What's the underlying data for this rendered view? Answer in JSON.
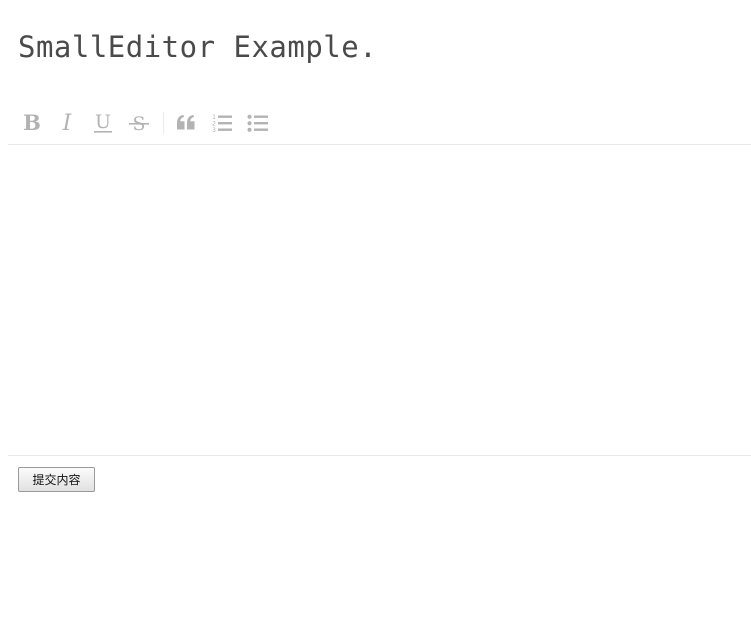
{
  "header": {
    "title": "SmallEditor Example."
  },
  "toolbar": {
    "buttons": [
      {
        "name": "bold",
        "icon": "bold-icon"
      },
      {
        "name": "italic",
        "icon": "italic-icon"
      },
      {
        "name": "underline",
        "icon": "underline-icon"
      },
      {
        "name": "strikethrough",
        "icon": "strikethrough-icon"
      },
      {
        "name": "blockquote",
        "icon": "quote-icon"
      },
      {
        "name": "ordered-list",
        "icon": "ordered-list-icon"
      },
      {
        "name": "unordered-list",
        "icon": "unordered-list-icon"
      }
    ],
    "icon_color": "#b3b3b3"
  },
  "editor": {
    "content": ""
  },
  "form": {
    "submit_label": "提交内容"
  }
}
